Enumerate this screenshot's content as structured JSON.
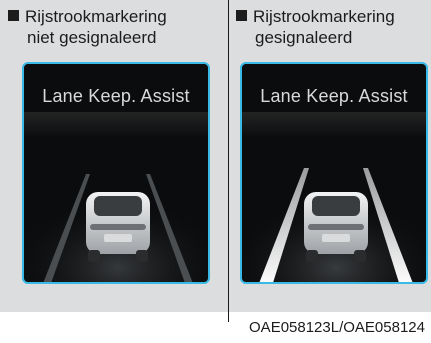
{
  "left": {
    "caption_line1": "Rijstrookmarkering",
    "caption_line2": "niet gesignaleerd",
    "display_title": "Lane Keep. Assist"
  },
  "right": {
    "caption_line1": "Rijstrookmarkering",
    "caption_line2": "gesignaleerd",
    "display_title": "Lane Keep. Assist"
  },
  "footer_code": "OAE058123L/OAE058124",
  "colors": {
    "screen_border": "#39b9e6",
    "screen_bg": "#0b0c0d",
    "panel_bg": "#dcdddf"
  },
  "icons": [
    "bullet-square-icon",
    "car-rear-icon",
    "lane-line-icon"
  ]
}
